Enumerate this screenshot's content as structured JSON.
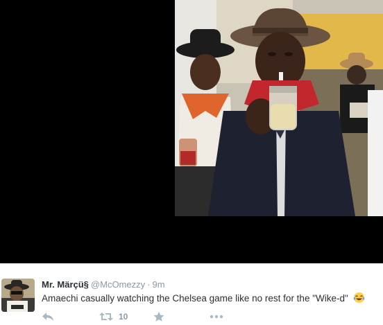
{
  "tweet": {
    "author_name": "Mr. Märçü§",
    "handle": "@McOmezzy",
    "separator": "·",
    "time": "9m",
    "text": "Amaechi casually watching the Chelsea game like no rest for the \"Wike-d\"",
    "emoji": "face-with-tears-of-joy",
    "retweet_count": "10"
  },
  "icons": {
    "reply": "reply-icon",
    "retweet": "retweet-icon",
    "favorite": "star-icon",
    "more": "more-icon"
  },
  "colors": {
    "media_background": "#000000",
    "text": "#292f33",
    "muted": "#8899a6",
    "action_icon": "#aab8c2"
  }
}
